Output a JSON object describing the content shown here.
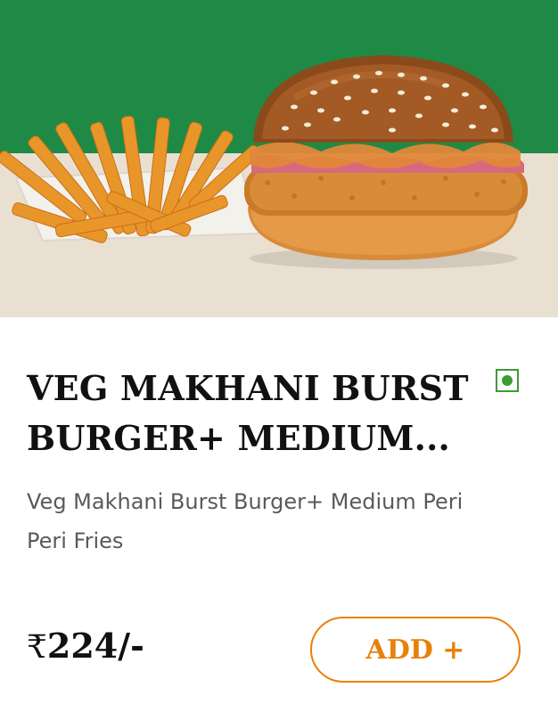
{
  "product": {
    "title": "VEG MAKHANI BURST BURGER+ MEDIUM...",
    "description": "Veg Makhani Burst Burger+ Medium Peri Peri Fries",
    "currency_symbol": "₹",
    "price": "224/-",
    "add_label": "ADD +",
    "veg_indicator": "veg-icon"
  },
  "colors": {
    "hero_green": "#1f8a45",
    "hero_beige": "#e9e0d2",
    "accent_orange": "#e8800a",
    "veg_green": "#3d9b34"
  }
}
